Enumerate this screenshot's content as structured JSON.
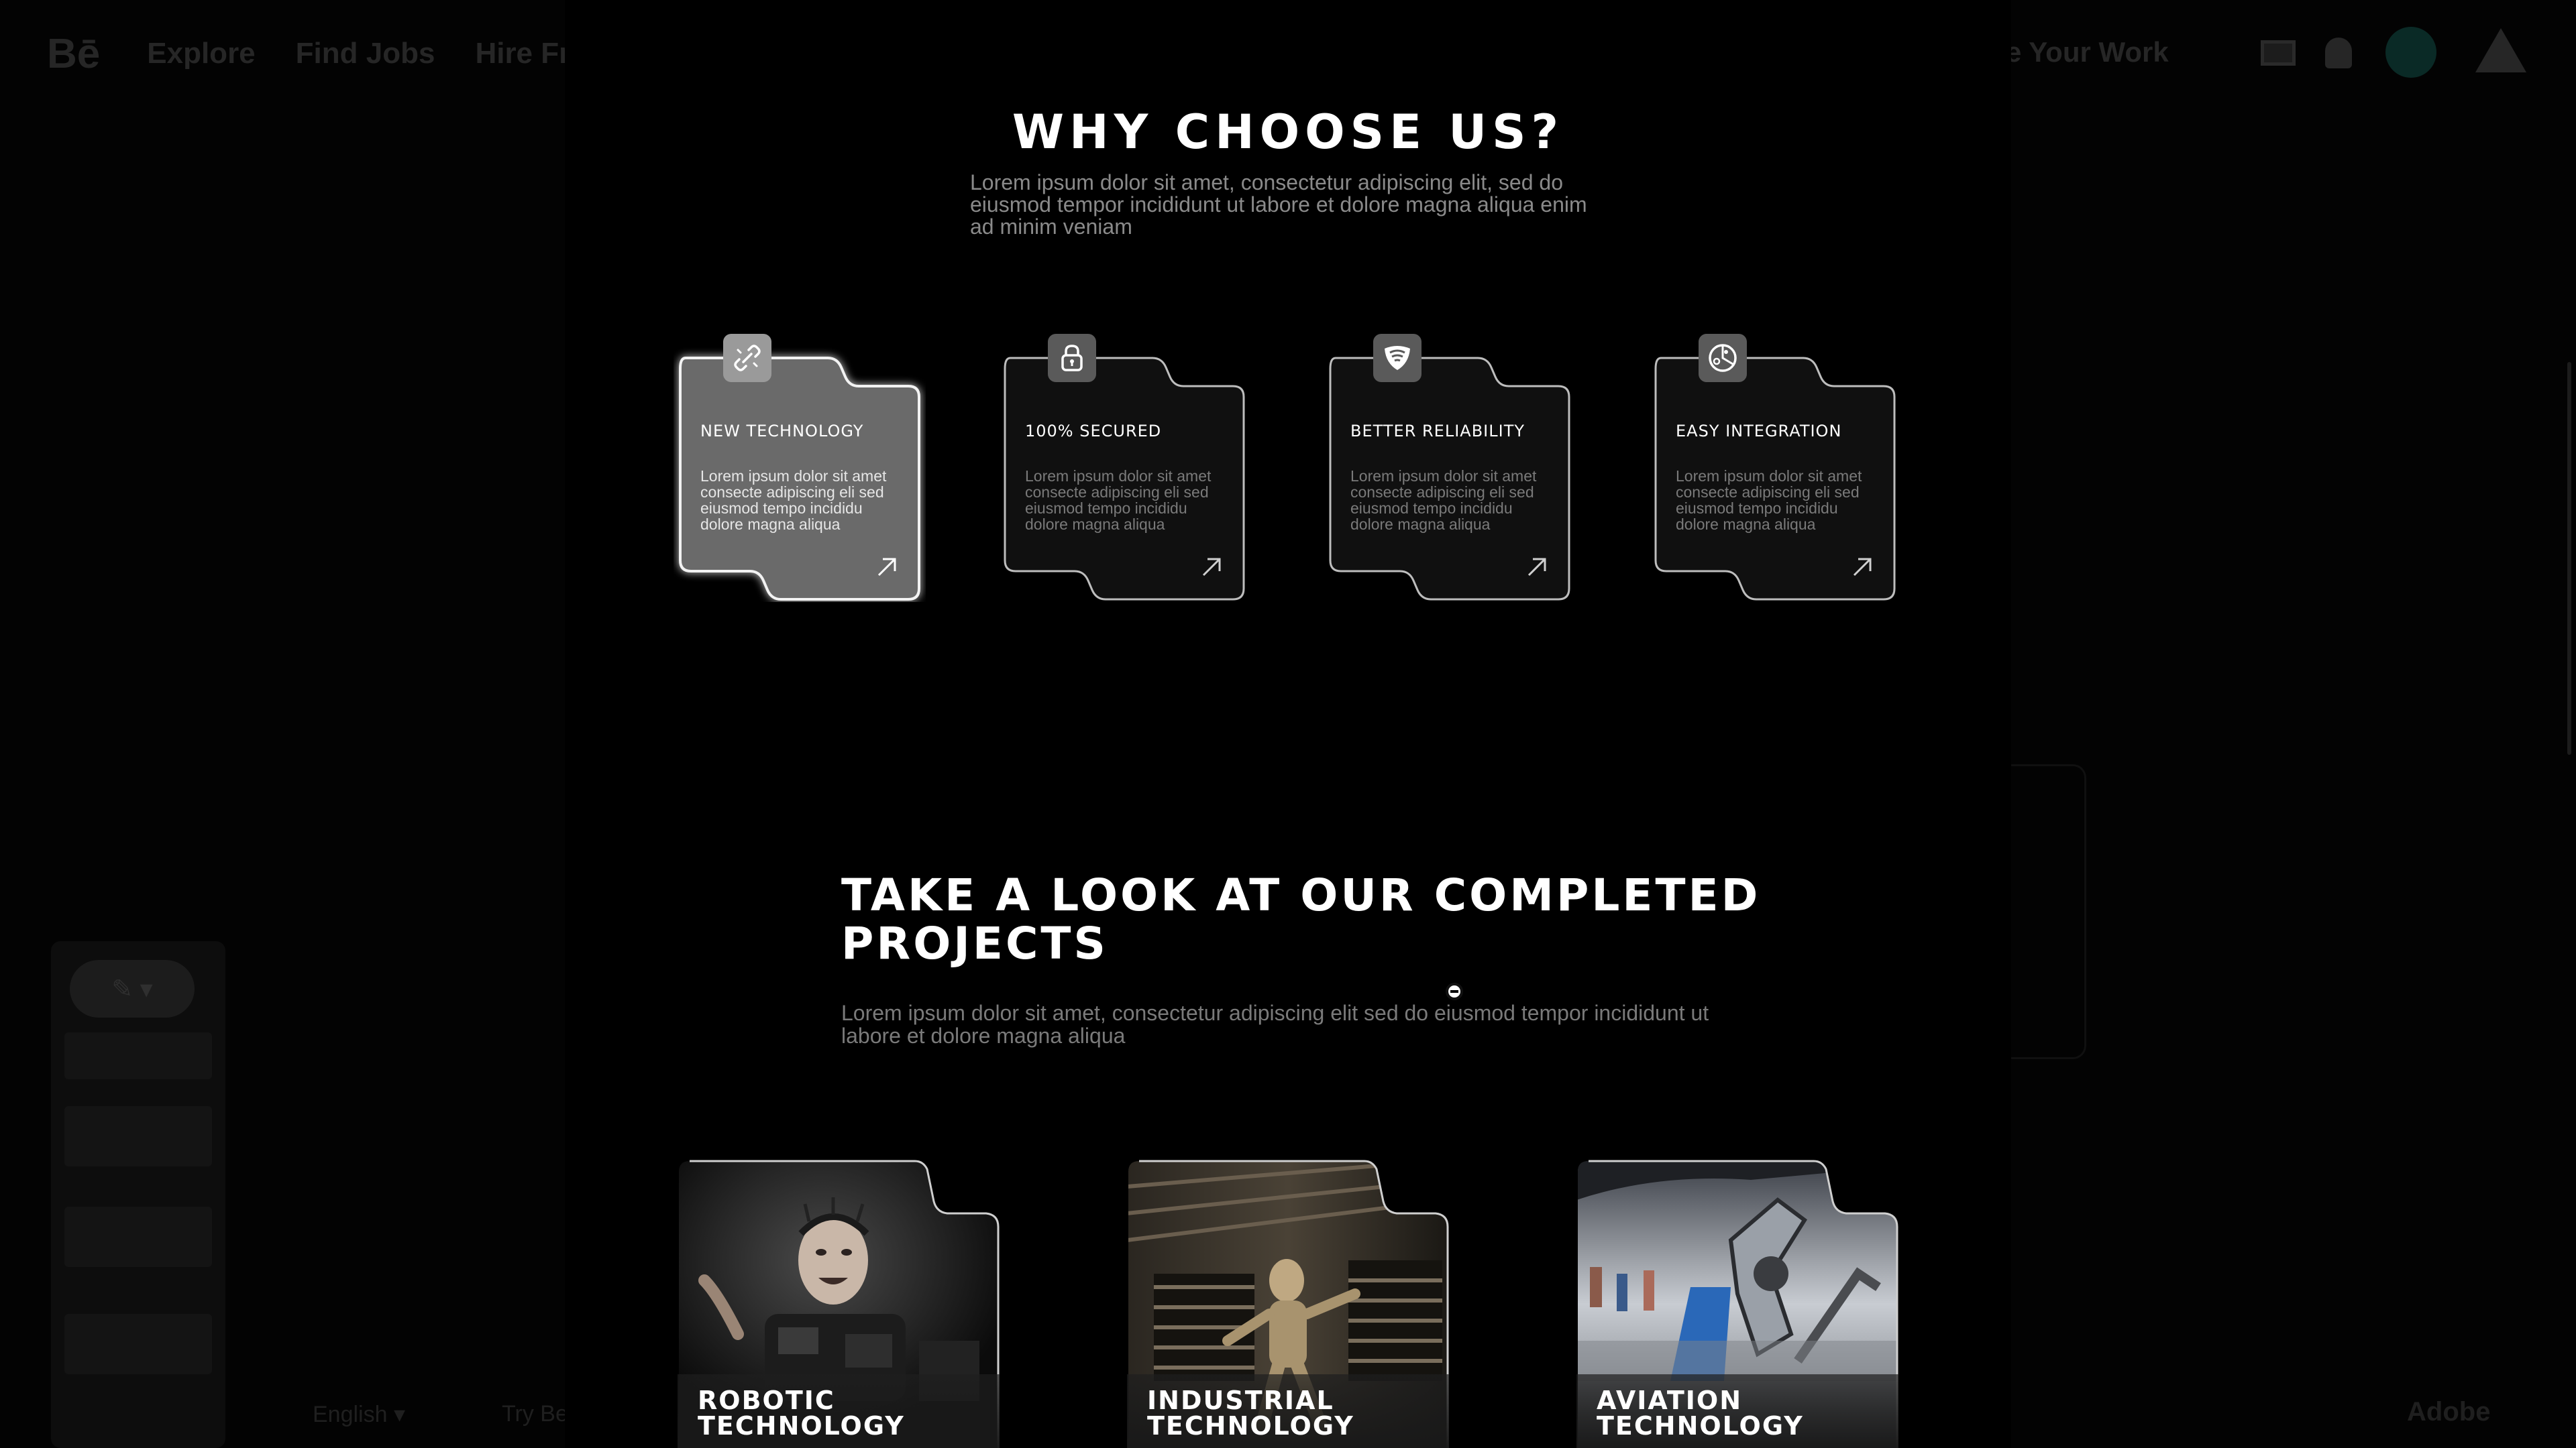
{
  "background": {
    "logo": "Bē",
    "nav": [
      "Explore",
      "Find Jobs",
      "Hire Fre"
    ],
    "share_label": "e Your Work",
    "footer": {
      "language": "English ▾",
      "try": "Try Be",
      "adobe": "Adobe"
    }
  },
  "why": {
    "title": "WHY CHOOSE US?",
    "lead": "Lorem ipsum dolor sit amet, consectetur adipiscing elit, sed do eiusmod tempor incididunt ut labore et dolore magna aliqua enim ad minim veniam",
    "features": [
      {
        "title": "NEW TECHNOLOGY",
        "desc": "Lorem ipsum dolor sit amet consecte adipiscing eli sed eiusmod tempo incididu dolore magna aliqua",
        "icon": "link-icon",
        "active": true
      },
      {
        "title": "100% SECURED",
        "desc": "Lorem ipsum dolor sit amet consecte adipiscing eli sed eiusmod tempo incididu dolore magna aliqua",
        "icon": "lock-icon",
        "active": false
      },
      {
        "title": "BETTER RELIABILITY",
        "desc": "Lorem ipsum dolor sit amet consecte adipiscing eli sed eiusmod tempo incididu dolore magna aliqua",
        "icon": "shield-icon",
        "active": false
      },
      {
        "title": "EASY INTEGRATION",
        "desc": "Lorem ipsum dolor sit amet consecte adipiscing eli sed eiusmod tempo incididu dolore magna aliqua",
        "icon": "integration-icon",
        "active": false
      }
    ]
  },
  "projects": {
    "title": "TAKE A LOOK AT OUR COMPLETED PROJECTS",
    "lead": "Lorem ipsum dolor sit amet, consectetur adipiscing elit sed do eiusmod tempor incididunt ut labore et dolore magna aliqua",
    "items": [
      {
        "title": "ROBOTIC TECHNOLOGY"
      },
      {
        "title": "INDUSTRIAL TECHNOLOGY"
      },
      {
        "title": "AVIATION TECHNOLOGY"
      }
    ]
  },
  "colors": {
    "modal_bg": "#000000",
    "card_active": "#6a6a6a",
    "card_inactive": "#121212",
    "text_muted": "#8a8a8a"
  }
}
